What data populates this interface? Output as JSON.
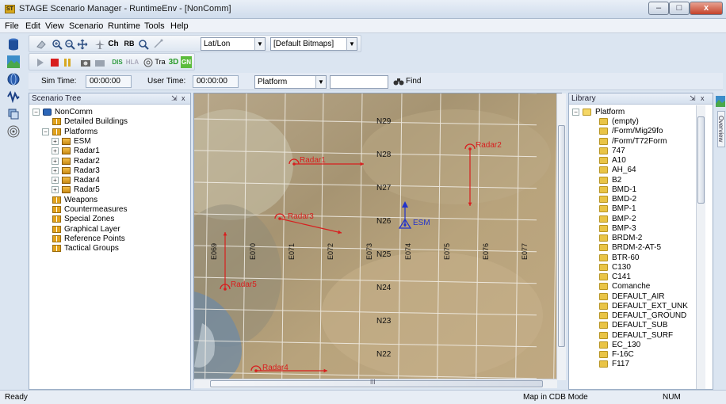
{
  "window": {
    "title": "STAGE Scenario Manager - RuntimeEnv - [NonComm]",
    "app_icon_text": "ST",
    "min_glyph": "–",
    "max_glyph": "□",
    "close_glyph": "x"
  },
  "menu": [
    "File",
    "Edit",
    "View",
    "Scenario",
    "Runtime",
    "Tools",
    "Help"
  ],
  "toolbar1": {
    "buttons": [
      "Ch",
      "RB"
    ],
    "coordinate_combo": "Lat/Lon",
    "bitmap_combo": "[Default Bitmaps]"
  },
  "toolbar2": {
    "buttons": [
      "DIS",
      "HLA",
      "Tra",
      "3D",
      "GN"
    ]
  },
  "timebar": {
    "sim_time_label": "Sim Time:",
    "sim_time_value": "00:00:00",
    "user_time_label": "User Time:",
    "user_time_value": "00:00:00",
    "filter_combo": "Platform",
    "search_value": "",
    "find_label": "Find"
  },
  "scenario_tree": {
    "title": "Scenario Tree",
    "pin_glyph": "F",
    "close_glyph": "x",
    "nodes": [
      {
        "label": "NonComm",
        "icon": "database-icon",
        "expander": "−"
      },
      {
        "label": "Detailed Buildings",
        "icon": "group-icon",
        "expander": ""
      },
      {
        "label": "Platforms",
        "icon": "group-icon",
        "expander": "−"
      },
      {
        "label": "ESM",
        "icon": "platform-icon",
        "expander": "+"
      },
      {
        "label": "Radar1",
        "icon": "platform-icon",
        "expander": "+"
      },
      {
        "label": "Radar2",
        "icon": "platform-icon",
        "expander": "+"
      },
      {
        "label": "Radar3",
        "icon": "platform-icon",
        "expander": "+"
      },
      {
        "label": "Radar4",
        "icon": "platform-icon",
        "expander": "+"
      },
      {
        "label": "Radar5",
        "icon": "platform-icon",
        "expander": "+"
      },
      {
        "label": "Weapons",
        "icon": "group-icon",
        "expander": ""
      },
      {
        "label": "Countermeasures",
        "icon": "group-icon",
        "expander": ""
      },
      {
        "label": "Special Zones",
        "icon": "group-icon",
        "expander": ""
      },
      {
        "label": "Graphical Layer",
        "icon": "group-icon",
        "expander": ""
      },
      {
        "label": "Reference Points",
        "icon": "group-icon",
        "expander": ""
      },
      {
        "label": "Tactical Groups",
        "icon": "group-icon",
        "expander": ""
      }
    ]
  },
  "map": {
    "latitude_labels": [
      "N29",
      "N28",
      "N27",
      "N26",
      "N25",
      "N24",
      "N23",
      "N22"
    ],
    "longitude_labels": [
      "E069",
      "E070",
      "E071",
      "E072",
      "E073",
      "E074",
      "E075",
      "E076",
      "E077"
    ],
    "entities": [
      {
        "name": "Radar1",
        "color": "#d81e1e"
      },
      {
        "name": "Radar2",
        "color": "#d81e1e"
      },
      {
        "name": "Radar3",
        "color": "#d81e1e"
      },
      {
        "name": "Radar4",
        "color": "#d81e1e"
      },
      {
        "name": "Radar5",
        "color": "#d81e1e"
      },
      {
        "name": "ESM",
        "color": "#2233cc"
      }
    ],
    "hscroll_glyph": "III"
  },
  "library": {
    "title": "Library",
    "pin_glyph": "F",
    "close_glyph": "x",
    "root": "Platform",
    "items": [
      "(empty)",
      "/Form/Mig29fo",
      "/Form/T72Form",
      "747",
      "A10",
      "AH_64",
      "B2",
      "BMD-1",
      "BMD-2",
      "BMP-1",
      "BMP-2",
      "BMP-3",
      "BRDM-2",
      "BRDM-2-AT-5",
      "BTR-60",
      "C130",
      "C141",
      "Comanche",
      "DEFAULT_AIR",
      "DEFAULT_EXT_UNK",
      "DEFAULT_GROUND",
      "DEFAULT_SUB",
      "DEFAULT_SURF",
      "EC_130",
      "F-16C",
      "F117"
    ]
  },
  "overview_tab": "Overview",
  "status": {
    "left": "Ready",
    "mode": "Map in CDB Mode",
    "num": "NUM"
  }
}
